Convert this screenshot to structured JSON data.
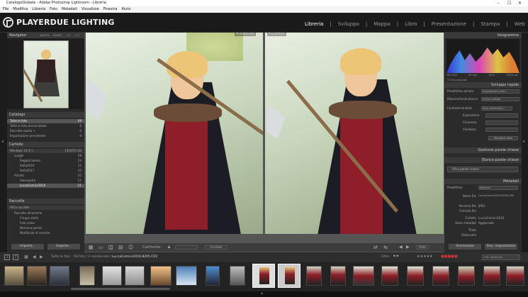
{
  "window": {
    "title": "CatalogoGlobale - Adobe Photoshop Lightroom - Libreria"
  },
  "menu": [
    "File",
    "Modifica",
    "Libreria",
    "Foto",
    "Metadati",
    "Visualizza",
    "Finestra",
    "Aiuto"
  ],
  "brand": "PLAYERDUE LIGHTING",
  "modules": [
    "Libreria",
    "Sviluppo",
    "Mappa",
    "Libro",
    "Presentazione",
    "Stampa",
    "Web"
  ],
  "left": {
    "navigator": {
      "title": "Navigator",
      "zoom": [
        "ADATTA",
        "RIEMPI",
        "1:1",
        "1:3"
      ]
    },
    "catalog": {
      "title": "Catalogo",
      "items": [
        {
          "label": "Tutte le foto",
          "count": "69"
        },
        {
          "label": "Tutte le foto sincronizzate",
          "count": "0"
        },
        {
          "label": "Raccolta rapida +",
          "count": "0"
        },
        {
          "label": "Importazione precedente",
          "count": "0"
        }
      ]
    },
    "folders": {
      "title": "Cartelle",
      "drive": "Windows 10 (C:)",
      "drive_info": "135/475 GB",
      "items": [
        {
          "label": "Luoghi",
          "count": "48"
        },
        {
          "label": "ReggioCalamo",
          "count": "24"
        },
        {
          "label": "Sofia2016",
          "count": "15"
        },
        {
          "label": "Sofia2017",
          "count": "15"
        },
        {
          "label": "Ritratti",
          "count": "42"
        },
        {
          "label": "Alessandra",
          "count": "21"
        },
        {
          "label": "LuccaComics2016",
          "count": "21"
        }
      ]
    },
    "collections": {
      "title": "Raccolte",
      "items": [
        {
          "label": "Filtra raccolte"
        },
        {
          "label": "Raccolte dinamiche"
        },
        {
          "label": "Cinque stelle"
        },
        {
          "label": "Foto video"
        },
        {
          "label": "Nessuna parola"
        },
        {
          "label": "Modificato di recente"
        }
      ]
    },
    "buttons": {
      "import": "Importa...",
      "export": "Esporta..."
    }
  },
  "center": {
    "before_label": "Selezionata",
    "after_label": "Candidata",
    "toolbar": {
      "compare": "Confronta:",
      "swap": "Scambia",
      "done": "Fatto"
    }
  },
  "right": {
    "histogram": {
      "title": "Istogramma",
      "info": [
        "ISO 200",
        "50 mm",
        "f/2,8",
        "1/200 sec"
      ],
      "original": "Foto originale"
    },
    "quick": {
      "title": "Sviluppo rapido",
      "preset_label": "Predefinito salvato",
      "preset_val": "Impostazioni pred...",
      "wb_label": "Bilanciamento bianco",
      "wb_val": "Come scattata",
      "tone_label": "Controllo tonalità",
      "tone_val": "Tono automatico",
      "rows": [
        "Esposizione",
        "Chiarezza",
        "Vividezza"
      ],
      "reset": "Ripristina tutto"
    },
    "keywords": {
      "title": "Gestione parole chiave"
    },
    "keywordlist": {
      "title": "Elenco parole chiave",
      "filter": "Filtra parole chiave"
    },
    "metadata": {
      "title": "Metadati",
      "preset_label": "Predefinito",
      "preset_val": "Nessuno",
      "rows": [
        {
          "label": "Nome file",
          "value": "LuccaComics2016-8295.CR2"
        },
        {
          "label": "Percorso file",
          "value": "JPEG"
        },
        {
          "label": "Formato file",
          "value": ""
        },
        {
          "label": "Cartella",
          "value": "LuccaComics2016"
        },
        {
          "label": "Stato metadati",
          "value": "Aggiornato"
        },
        {
          "label": "Titolo",
          "value": ""
        },
        {
          "label": "Didascalia",
          "value": ""
        }
      ]
    },
    "buttons": {
      "sync": "Sincronizza",
      "sync_settings": "Sinc. impostazioni"
    }
  },
  "bottombar": {
    "source": "Tutte le foto",
    "count": "69 foto / 2 selezionate /",
    "file": "LuccaComics2016-8295.CR2",
    "filter_label": "Filtro:",
    "filter_val": "Filtri disattivati"
  },
  "colors": {
    "accent": "#2b2b2b",
    "panelHeader": "#3a3a3a",
    "selected": "#555555"
  }
}
